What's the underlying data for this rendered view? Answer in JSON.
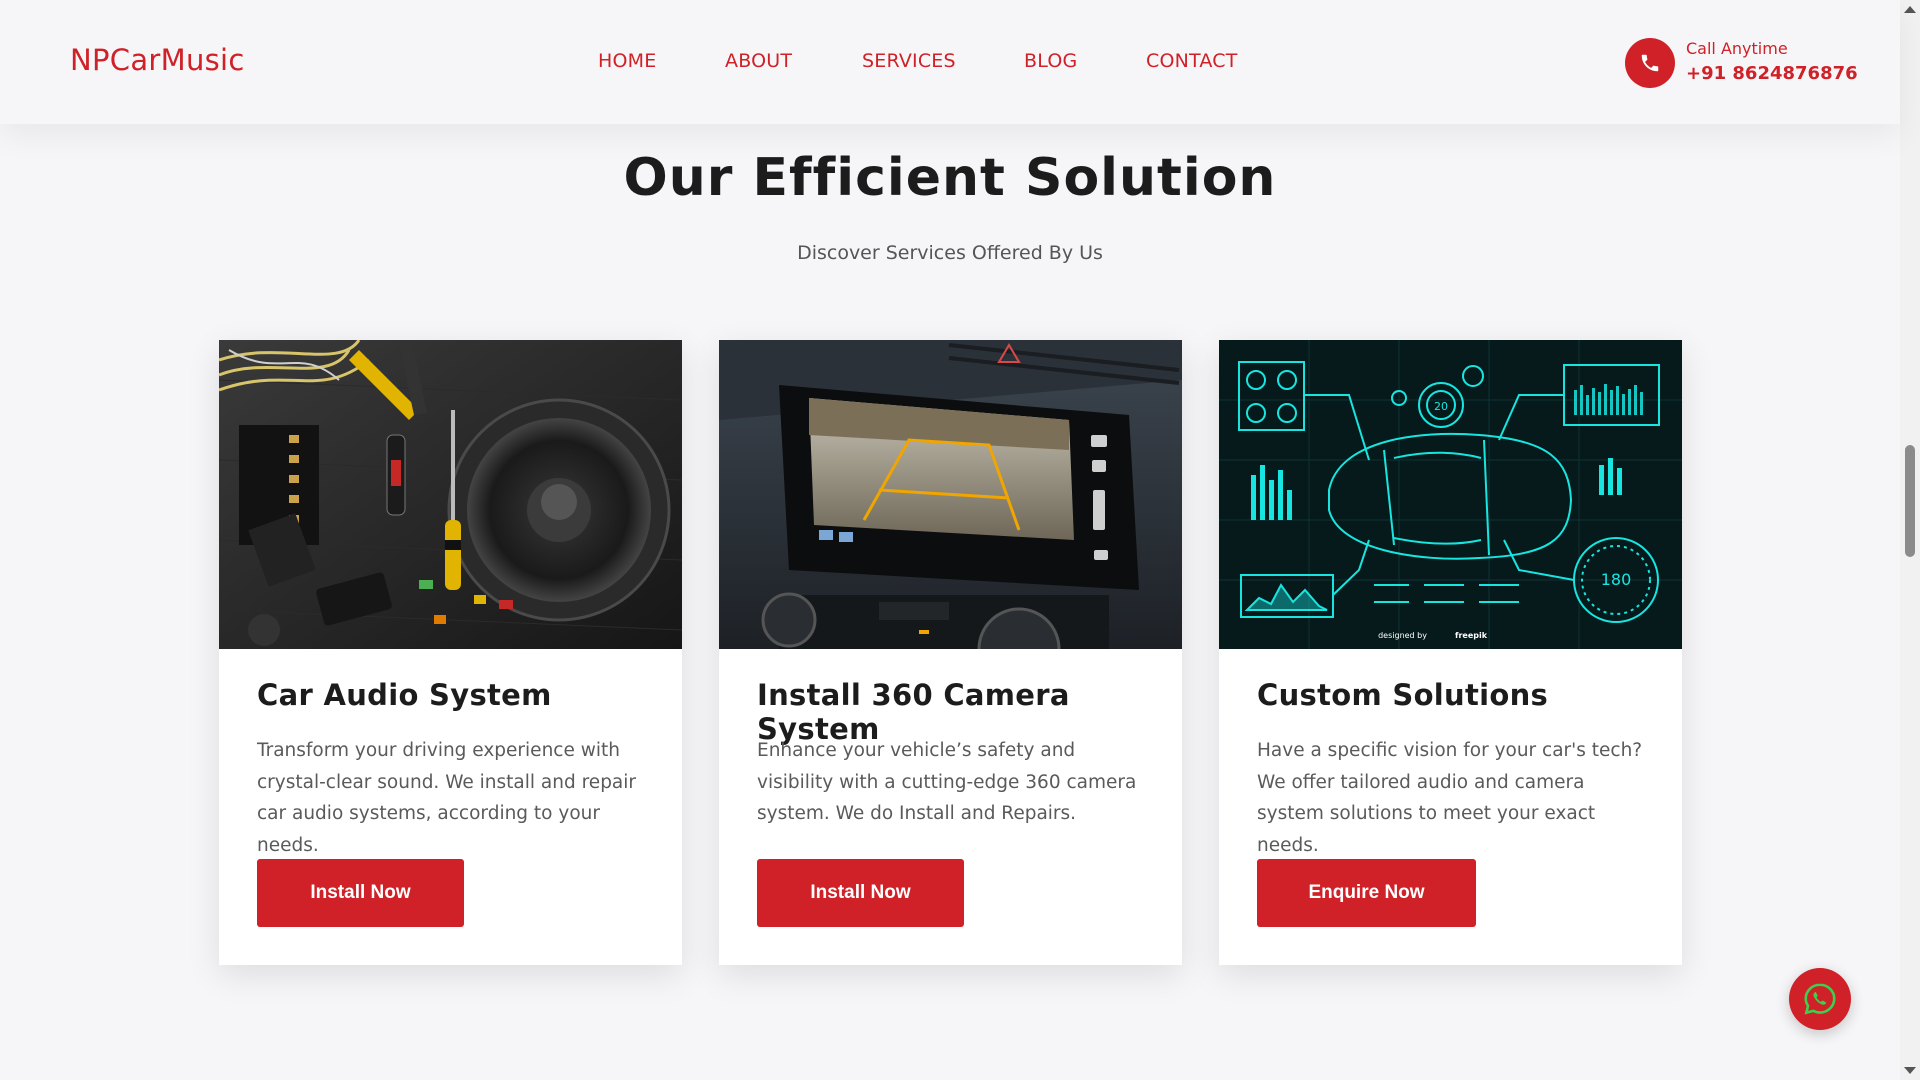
{
  "header": {
    "logo": "NPCarMusic",
    "nav": [
      "HOME",
      "ABOUT",
      "SERVICES",
      "BLOG",
      "CONTACT"
    ],
    "call_label": "Call Anytime",
    "call_number": "+91 8624876876",
    "icons": {
      "call": "phone-icon"
    }
  },
  "section": {
    "title": "Our Efficient Solution",
    "subtitle": "Discover Services Offered By Us"
  },
  "cards": [
    {
      "title": "Car Audio System",
      "description": "Transform your driving experience with crystal-clear sound. We install and repair car audio systems, according to your needs.",
      "button": "Install Now",
      "image": "car-audio-tools-speaker-image"
    },
    {
      "title": "Install 360 Camera System",
      "description": "Enhance your vehicle’s safety and visibility with a cutting-edge 360 camera system. We do Install and Repairs.",
      "button": "Install Now",
      "image": "car-dashboard-camera-screen-image"
    },
    {
      "title": "Custom Solutions",
      "description": "Have a specific vision for your car's tech? We offer tailored audio and camera system solutions to meet your exact needs.",
      "button": "Enquire Now",
      "image": "car-hud-blueprint-image",
      "image_text": {
        "gauge_small": "20",
        "gauge_large": "180",
        "credit_prefix": "designed by",
        "credit_brand": "freepik"
      }
    }
  ],
  "floating": {
    "chat_icon": "whatsapp-icon"
  },
  "colors": {
    "brand_red": "#cf2127",
    "background": "#f6f6f8",
    "heading": "#1c1c1c",
    "body_text": "#5a5a5a",
    "hud_cyan": "#17e6e0",
    "hud_bg": "#061a1c"
  }
}
